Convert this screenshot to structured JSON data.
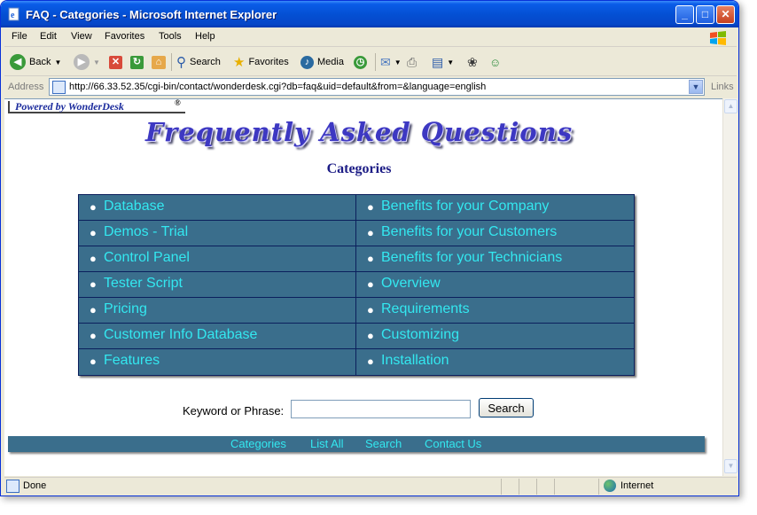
{
  "window": {
    "title": "FAQ - Categories - Microsoft Internet Explorer"
  },
  "menu": [
    "File",
    "Edit",
    "View",
    "Favorites",
    "Tools",
    "Help"
  ],
  "toolbar": {
    "back": "Back",
    "search": "Search",
    "favorites": "Favorites",
    "media": "Media"
  },
  "address": {
    "label": "Address",
    "url": "http://66.33.52.35/cgi-bin/contact/wonderdesk.cgi?db=faq&uid=default&from=&language=english",
    "links": "Links"
  },
  "page": {
    "powered_by": "Powered by WonderDesk",
    "powered_mark": "®",
    "title": "Frequently Asked Questions",
    "heading": "Categories",
    "categories_left": [
      "Database",
      "Demos - Trial",
      "Control Panel",
      "Tester Script",
      "Pricing",
      "Customer Info Database",
      "Features"
    ],
    "categories_right": [
      "Benefits for your Company",
      "Benefits for your Customers",
      "Benefits for your Technicians",
      "Overview",
      "Requirements",
      "Customizing",
      "Installation"
    ],
    "keyword_label": "Keyword or Phrase:",
    "keyword_value": "",
    "search_button": "Search",
    "footer_links": [
      "Categories",
      "List All",
      "Search",
      "Contact Us"
    ],
    "colors": {
      "table_bg": "#3a6e8c",
      "link": "#33e8f0",
      "heading": "#1d1d86"
    }
  },
  "status": {
    "text": "Done",
    "zone": "Internet"
  }
}
